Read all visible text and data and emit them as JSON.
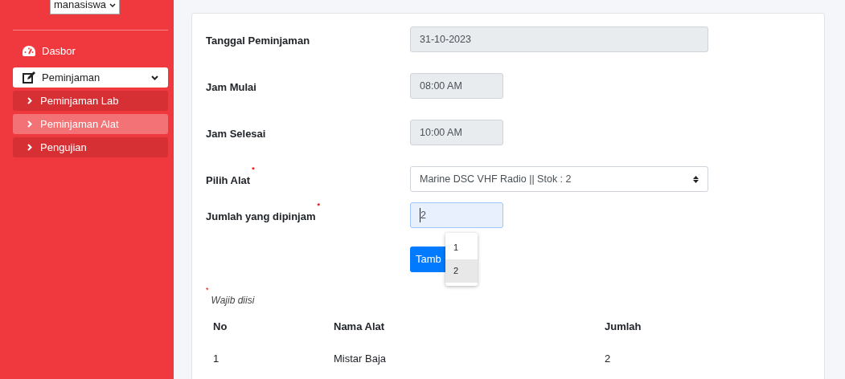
{
  "sidebar": {
    "role_select": {
      "value": "manasiswa"
    },
    "items": [
      {
        "label": "Dasbor",
        "kind": "link",
        "selected": false
      },
      {
        "label": "Peminjaman",
        "kind": "group",
        "selected": true,
        "expanded": true,
        "children": [
          {
            "label": "Peminjaman Lab",
            "selected": false
          },
          {
            "label": "Peminjaman Alat",
            "selected": true
          },
          {
            "label": "Pengujian",
            "selected": false
          }
        ]
      }
    ]
  },
  "form": {
    "fields": [
      {
        "label": "Tanggal Peminjaman",
        "kind": "date",
        "value": "31-10-2023"
      },
      {
        "label": "Jam Mulai",
        "kind": "time",
        "value": "08:00 AM"
      },
      {
        "label": "Jam Selesai",
        "kind": "time",
        "value": "10:00 AM"
      },
      {
        "label": "Pilih Alat",
        "kind": "select",
        "value": "Marine DSC VHF Radio || Stok : 2",
        "required_mark": "*"
      },
      {
        "label": "Jumlah yang dipinjam",
        "kind": "number",
        "value": "2",
        "required_mark": "*",
        "focused": true,
        "suggestions": [
          {
            "label": "1",
            "selected": false
          },
          {
            "label": "2",
            "selected": true
          }
        ]
      }
    ],
    "submit_button": "Tamb",
    "required_note": {
      "mark": "*",
      "text": "Wajib diisi"
    }
  },
  "table": {
    "columns": [
      "No",
      "Nama Alat",
      "Jumlah"
    ],
    "rows": [
      [
        "1",
        "Mistar Baja",
        "2"
      ]
    ]
  }
}
